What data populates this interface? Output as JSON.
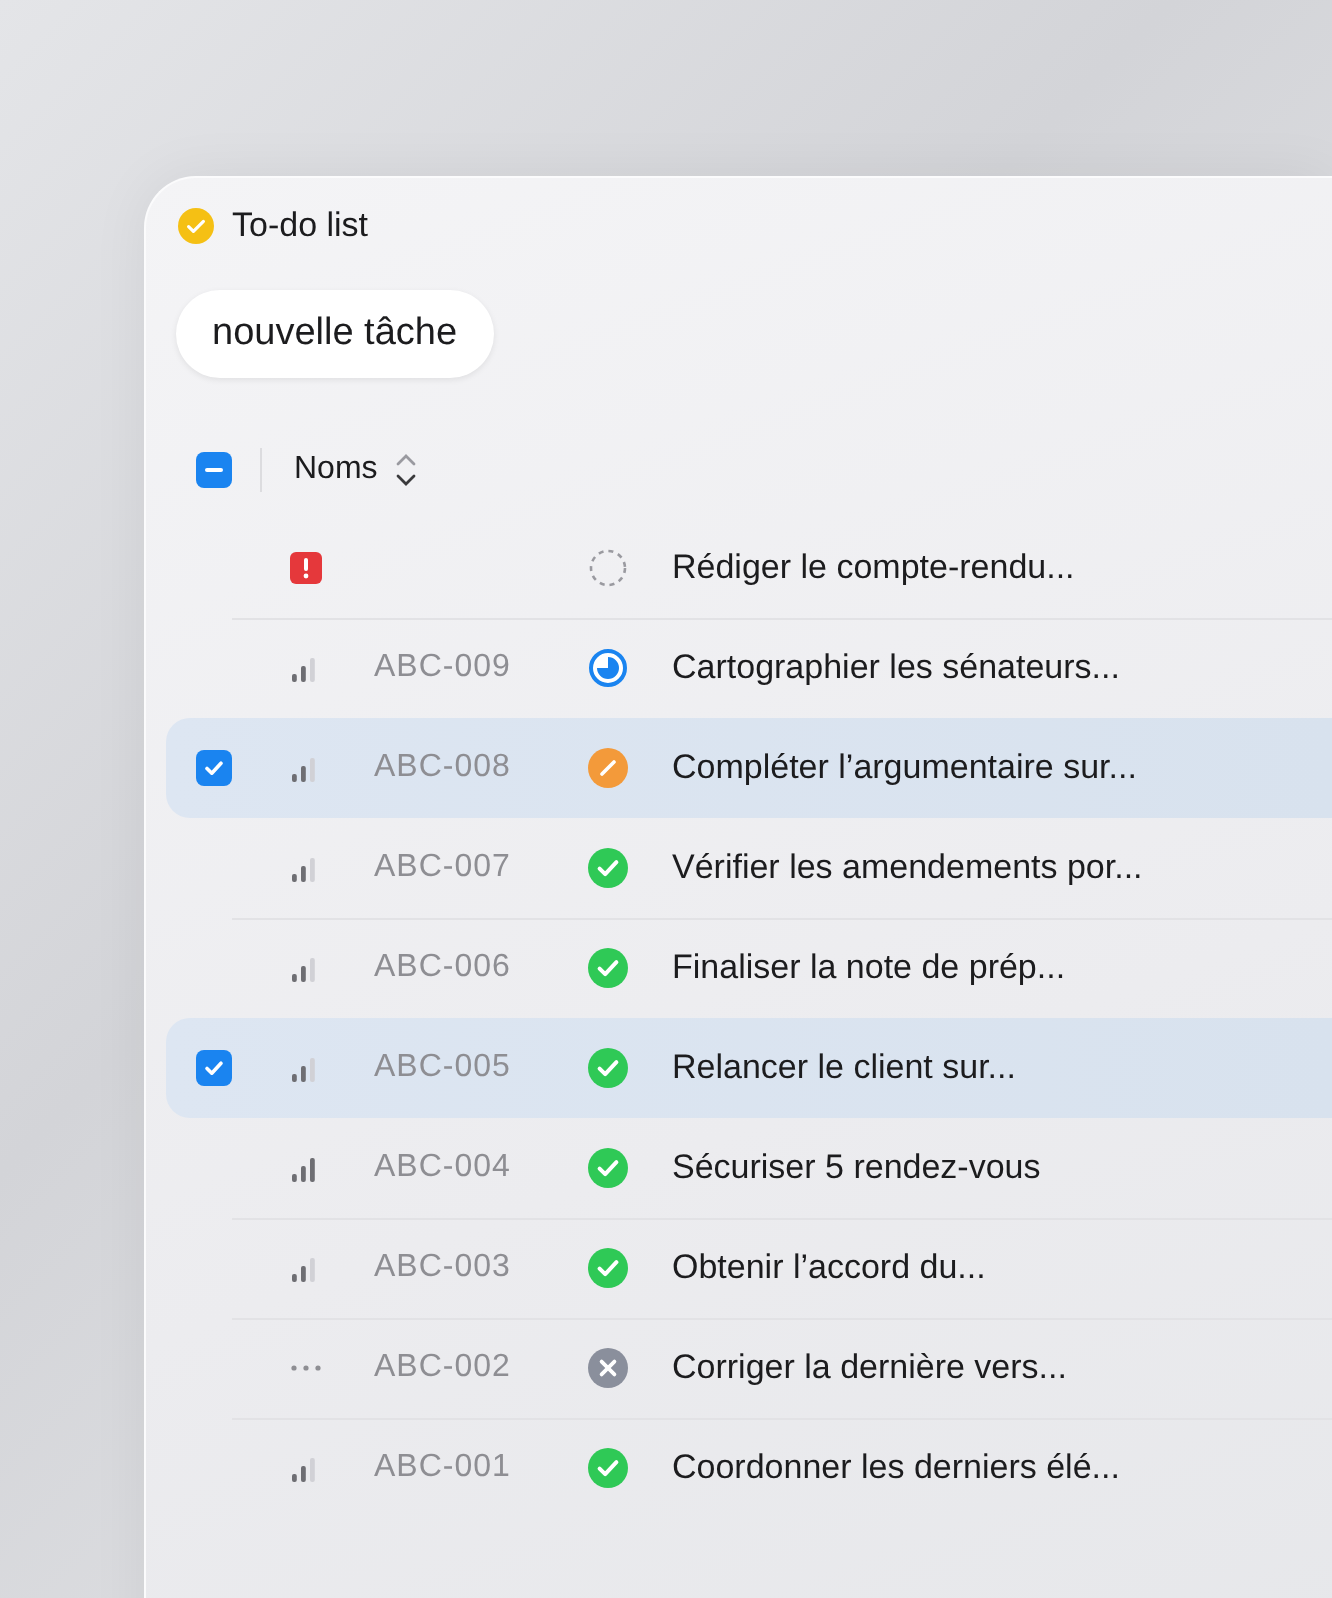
{
  "window": {
    "title": "To-do list"
  },
  "new_task_button": {
    "label": "nouvelle tâche"
  },
  "header": {
    "indeterminate": true,
    "column": "Noms"
  },
  "rows": [
    {
      "selected": false,
      "priority": {
        "kind": "urgent"
      },
      "id": "",
      "status": {
        "kind": "todo"
      },
      "title": "Rédiger le compte-rendu..."
    },
    {
      "selected": false,
      "priority": {
        "kind": "medium"
      },
      "id": "ABC-009",
      "status": {
        "kind": "progress"
      },
      "title": "Cartographier les sénateurs..."
    },
    {
      "selected": true,
      "priority": {
        "kind": "medium"
      },
      "id": "ABC-008",
      "status": {
        "kind": "review"
      },
      "title": "Compléter l’argumentaire sur..."
    },
    {
      "selected": false,
      "priority": {
        "kind": "medium"
      },
      "id": "ABC-007",
      "status": {
        "kind": "done"
      },
      "title": "Vérifier les amendements por..."
    },
    {
      "selected": false,
      "priority": {
        "kind": "medium"
      },
      "id": "ABC-006",
      "status": {
        "kind": "done"
      },
      "title": "Finaliser la note de prép..."
    },
    {
      "selected": true,
      "priority": {
        "kind": "medium"
      },
      "id": "ABC-005",
      "status": {
        "kind": "done"
      },
      "title": "Relancer le client sur..."
    },
    {
      "selected": false,
      "priority": {
        "kind": "high"
      },
      "id": "ABC-004",
      "status": {
        "kind": "done"
      },
      "title": "Sécuriser 5 rendez-vous"
    },
    {
      "selected": false,
      "priority": {
        "kind": "medium"
      },
      "id": "ABC-003",
      "status": {
        "kind": "done"
      },
      "title": "Obtenir l’accord du..."
    },
    {
      "selected": false,
      "priority": {
        "kind": "none"
      },
      "id": "ABC-002",
      "status": {
        "kind": "canceled"
      },
      "title": "Corriger la dernière vers..."
    },
    {
      "selected": false,
      "priority": {
        "kind": "medium"
      },
      "id": "ABC-001",
      "status": {
        "kind": "done"
      },
      "title": "Coordonner les derniers élé..."
    }
  ]
}
